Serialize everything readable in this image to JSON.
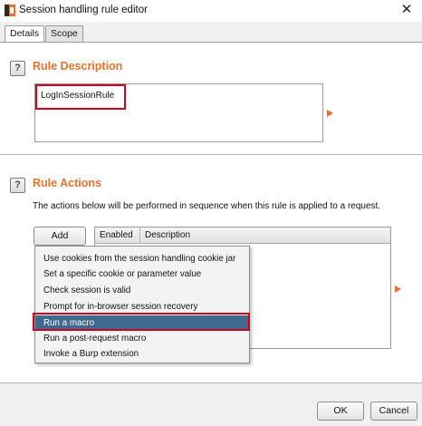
{
  "window": {
    "title": "Session handling rule editor",
    "close_glyph": "✕"
  },
  "tabs": [
    {
      "label": "Details",
      "active": true
    },
    {
      "label": "Scope",
      "active": false
    }
  ],
  "rule_description": {
    "heading": "Rule Description",
    "value": "LogInSessionRule",
    "help_glyph": "?"
  },
  "rule_actions": {
    "heading": "Rule Actions",
    "help_glyph": "?",
    "hint": "The actions below will be performed in sequence when this rule is applied to a request.",
    "add_label": "Add",
    "columns": [
      "Enabled",
      "Description"
    ]
  },
  "add_menu": {
    "items": [
      "Use cookies from the session handling cookie jar",
      "Set a specific cookie or parameter value",
      "Check session is valid",
      "Prompt for in-browser session recovery",
      "Run a macro",
      "Run a post-request macro",
      "Invoke a Burp extension"
    ],
    "selected": "Run a macro"
  },
  "footer": {
    "ok_label": "OK",
    "cancel_label": "Cancel"
  },
  "colors": {
    "accent": "#e8722c",
    "highlight": "#d0021b",
    "selection": "#3f6a8e"
  },
  "icons": [
    "burp-app-icon",
    "close-icon",
    "help-icon",
    "arrow-right-icon"
  ]
}
